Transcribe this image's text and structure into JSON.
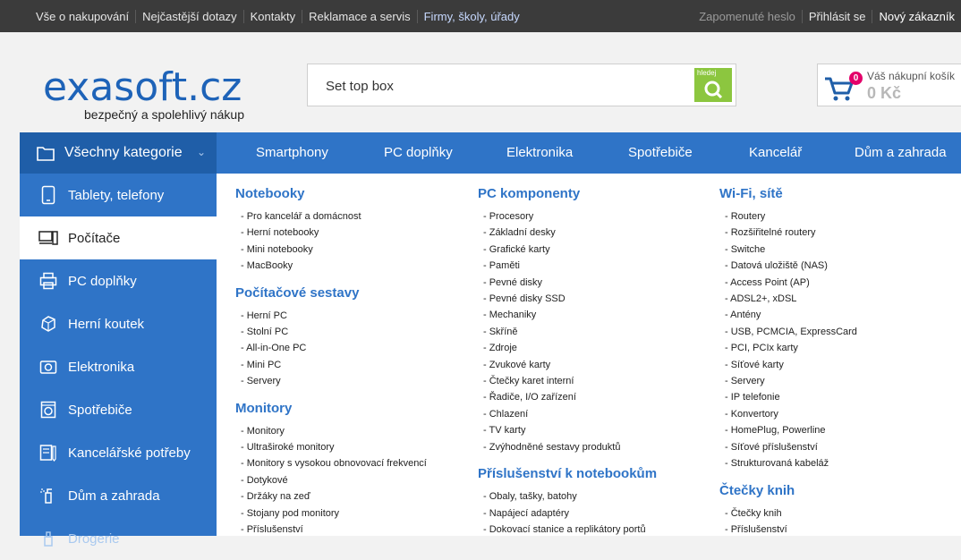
{
  "topbar": {
    "left": [
      "Vše o nakupování",
      "Nejčastější dotazy",
      "Kontakty",
      "Reklamace a servis",
      "Firmy, školy, úřady"
    ],
    "forgot": "Zapomenuté heslo",
    "login": "Přihlásit se",
    "register": "Nový zákazník"
  },
  "logo": {
    "text": "exasoft.cz",
    "tagline": "bezpečný a spolehlivý nákup"
  },
  "search": {
    "value": "Set top box",
    "button_label": "hledej"
  },
  "cart": {
    "count": "0",
    "title": "Váš nákupní košík",
    "amount": "0 Kč"
  },
  "nav": {
    "all_categories": "Všechny kategorie",
    "items": [
      "Smartphony",
      "PC doplňky",
      "Elektronika",
      "Spotřebiče",
      "Kancelář",
      "Dům a zahrada"
    ]
  },
  "sidebar": {
    "items": [
      {
        "label": "Tablety, telefony",
        "icon": "tablet-icon"
      },
      {
        "label": "Počítače",
        "icon": "computer-icon"
      },
      {
        "label": "PC doplňky",
        "icon": "printer-icon"
      },
      {
        "label": "Herní koutek",
        "icon": "dice-icon"
      },
      {
        "label": "Elektronika",
        "icon": "camera-icon"
      },
      {
        "label": "Spotřebiče",
        "icon": "washing-machine-icon"
      },
      {
        "label": "Kancelářské potřeby",
        "icon": "office-icon"
      },
      {
        "label": "Dům a zahrada",
        "icon": "watering-icon"
      },
      {
        "label": "Drogerie",
        "icon": "drugstore-icon"
      }
    ]
  },
  "menu": {
    "col1": [
      {
        "title": "Notebooky",
        "items": [
          "- Pro kancelář a domácnost",
          "- Herní notebooky",
          "- Mini notebooky",
          "- MacBooky"
        ]
      },
      {
        "title": "Počítačové sestavy",
        "items": [
          "- Herní PC",
          "- Stolní PC",
          "- All-in-One PC",
          "- Mini PC",
          "- Servery"
        ]
      },
      {
        "title": "Monitory",
        "items": [
          "- Monitory",
          "- Ultraširoké monitory",
          "- Monitory s vysokou obnovovací frekvencí",
          "- Dotykové",
          "- Držáky na zeď",
          "- Stojany pod monitory",
          "- Příslušenství"
        ]
      }
    ],
    "col2": [
      {
        "title": "PC komponenty",
        "items": [
          "- Procesory",
          "- Základní desky",
          "- Grafické karty",
          "- Paměti",
          "- Pevné disky",
          "- Pevné disky SSD",
          "- Mechaniky",
          "- Skříně",
          "- Zdroje",
          "- Zvukové karty",
          "- Čtečky karet interní",
          "- Řadiče, I/O zařízení",
          "- Chlazení",
          "- TV karty",
          "- Zvýhodněné sestavy produktů"
        ]
      },
      {
        "title": "Příslušenství k notebookům",
        "items": [
          "- Obaly, tašky, batohy",
          "- Napájecí adaptéry",
          "- Dokovací stanice a replikátory portů"
        ]
      }
    ],
    "col3": [
      {
        "title": "Wi-Fi, sítě",
        "items": [
          "- Routery",
          "- Rozšiřitelné routery",
          "- Switche",
          "- Datová uložiště (NAS)",
          "- Access Point (AP)",
          "- ADSL2+, xDSL",
          "- Antény",
          "- USB, PCMCIA, ExpressCard",
          "- PCI, PCIx karty",
          "- Síťové karty",
          "- Servery",
          "- IP telefonie",
          "- Konvertory",
          "- HomePlug, Powerline",
          "- Síťové příslušenství",
          "- Strukturovaná kabeláž"
        ]
      },
      {
        "title": "Čtečky knih",
        "items": [
          "- Čtečky knih",
          "- Příslušenství"
        ]
      }
    ]
  }
}
